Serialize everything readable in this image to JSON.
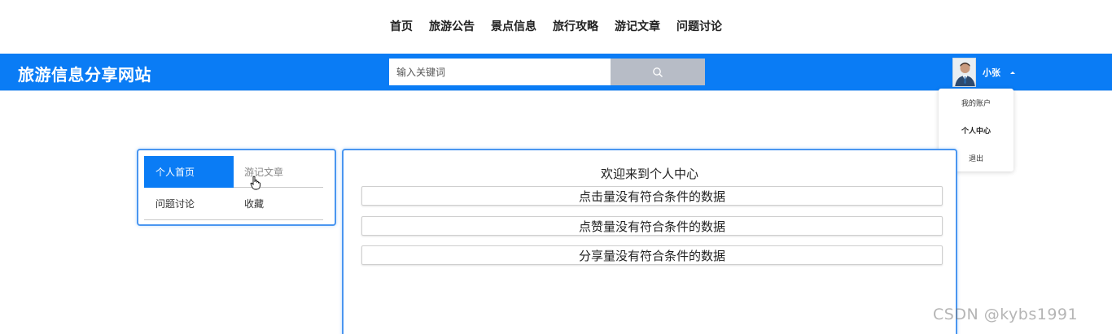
{
  "topnav": {
    "items": [
      "首页",
      "旅游公告",
      "景点信息",
      "旅行攻略",
      "游记文章",
      "问题讨论"
    ]
  },
  "header": {
    "site_title": "旅游信息分享网站",
    "search_placeholder": "输入关键词",
    "search_icon": "search-icon",
    "user_name": "小张"
  },
  "user_menu": {
    "items": [
      "我的账户",
      "个人中心",
      "退出"
    ]
  },
  "sidebar": {
    "tabs": [
      "个人首页",
      "游记文章",
      "问题讨论",
      "收藏"
    ],
    "active": "个人首页"
  },
  "main": {
    "welcome": "欢迎来到个人中心",
    "stats": [
      "点击量没有符合条件的数据",
      "点赞量没有符合条件的数据",
      "分享量没有符合条件的数据"
    ]
  },
  "watermark": "CSDN @kybs1991",
  "colors": {
    "brand": "#0a7cf5",
    "search_button": "#b7bcc6",
    "card_border": "#4a96f0"
  }
}
